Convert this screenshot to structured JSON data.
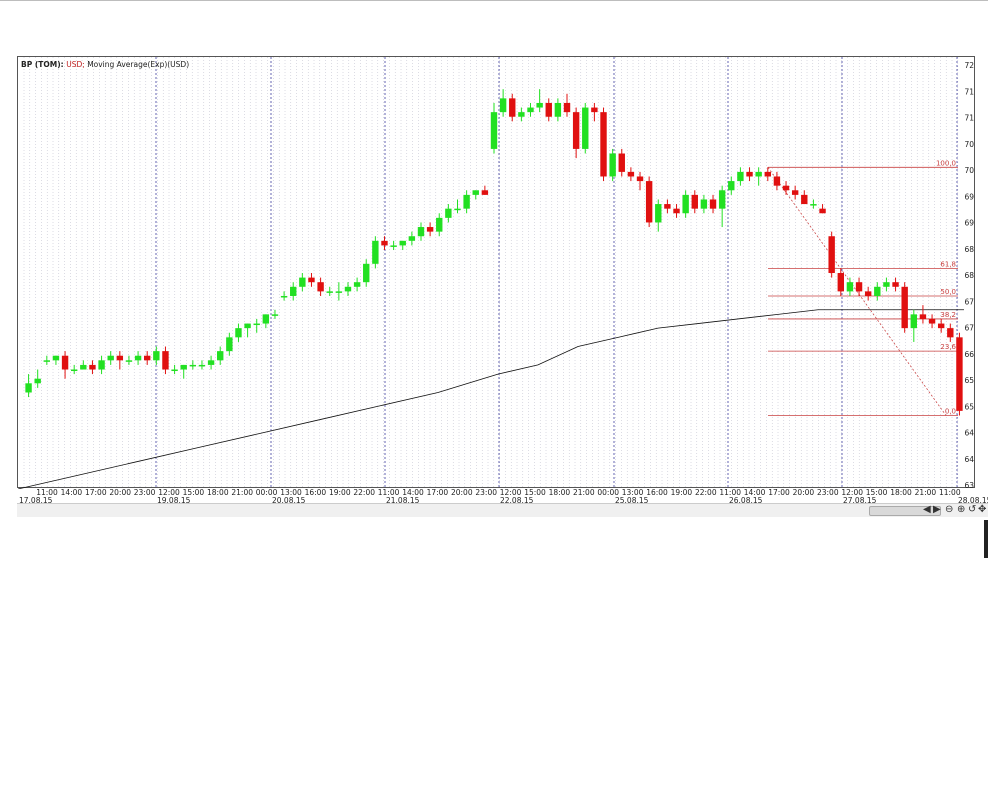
{
  "chart": {
    "legend_symbol": "BP (TOM):",
    "legend_currency": "USD;",
    "legend_indicator": "Moving Average(Exp)(USD)",
    "up_color": "#22e022",
    "down_color": "#e01010",
    "fib_color": "#c84040",
    "grid_color": "#b8b8c8",
    "day_sep_color": "#4040a0"
  },
  "icons": [
    "scroll-left-icon",
    "scroll-right-icon",
    "zoom-out-icon",
    "zoom-in-icon",
    "reset-icon",
    "move-icon"
  ],
  "chart_data": {
    "type": "candlestick",
    "ylim": [
      62.8,
      72.2
    ],
    "y_ticks": [
      "63",
      "64",
      "64",
      "65",
      "65",
      "66",
      "67",
      "67",
      "68",
      "68",
      "69",
      "69",
      "70",
      "70",
      "71",
      "71",
      "72"
    ],
    "time_labels": [
      "11:00",
      "14:00",
      "17:00",
      "20:00",
      "23:00",
      "12:00",
      "15:00",
      "18:00",
      "21:00",
      "00:00",
      "13:00",
      "16:00",
      "19:00",
      "22:00",
      "11:00",
      "14:00",
      "17:00",
      "20:00",
      "23:00",
      "12:00",
      "15:00",
      "18:00",
      "21:00",
      "00:00",
      "13:00",
      "16:00",
      "19:00",
      "22:00",
      "11:00",
      "14:00",
      "17:00",
      "20:00",
      "23:00",
      "12:00",
      "15:00",
      "18:00",
      "21:00",
      "11:00"
    ],
    "date_labels": [
      "17.08.15",
      "19.08.15",
      "20.08.15",
      "21.08.15",
      "22.08.15",
      "25.08.15",
      "26.08.15",
      "27.08.15",
      "28.08.15"
    ],
    "fib_levels": [
      "100,0",
      "61,8",
      "50,0",
      "38,2",
      "23,6",
      "0,0"
    ],
    "fib_values": [
      69.8,
      67.6,
      67.0,
      66.5,
      65.8,
      64.4
    ],
    "candles": [
      [
        64.9,
        65.3,
        64.8,
        65.1
      ],
      [
        65.1,
        65.4,
        65.0,
        65.2
      ],
      [
        65.6,
        65.7,
        65.5,
        65.6
      ],
      [
        65.6,
        65.7,
        65.5,
        65.7
      ],
      [
        65.7,
        65.8,
        65.2,
        65.4
      ],
      [
        65.4,
        65.5,
        65.3,
        65.4
      ],
      [
        65.4,
        65.6,
        65.4,
        65.5
      ],
      [
        65.5,
        65.6,
        65.3,
        65.4
      ],
      [
        65.4,
        65.7,
        65.3,
        65.6
      ],
      [
        65.6,
        65.8,
        65.5,
        65.7
      ],
      [
        65.7,
        65.8,
        65.4,
        65.6
      ],
      [
        65.6,
        65.7,
        65.5,
        65.6
      ],
      [
        65.6,
        65.8,
        65.5,
        65.7
      ],
      [
        65.7,
        65.8,
        65.5,
        65.6
      ],
      [
        65.6,
        65.9,
        65.5,
        65.8
      ],
      [
        65.8,
        65.9,
        65.3,
        65.4
      ],
      [
        65.4,
        65.5,
        65.3,
        65.4
      ],
      [
        65.4,
        65.5,
        65.2,
        65.5
      ],
      [
        65.5,
        65.6,
        65.4,
        65.5
      ],
      [
        65.5,
        65.6,
        65.4,
        65.5
      ],
      [
        65.5,
        65.7,
        65.4,
        65.6
      ],
      [
        65.6,
        65.9,
        65.5,
        65.8
      ],
      [
        65.8,
        66.2,
        65.7,
        66.1
      ],
      [
        66.1,
        66.4,
        66.0,
        66.3
      ],
      [
        66.3,
        66.4,
        66.1,
        66.4
      ],
      [
        66.4,
        66.5,
        66.2,
        66.4
      ],
      [
        66.4,
        66.6,
        66.3,
        66.6
      ],
      [
        66.6,
        66.7,
        66.5,
        66.6
      ],
      [
        67.0,
        67.1,
        66.9,
        67.0
      ],
      [
        67.0,
        67.3,
        66.9,
        67.2
      ],
      [
        67.2,
        67.5,
        67.1,
        67.4
      ],
      [
        67.4,
        67.5,
        67.2,
        67.3
      ],
      [
        67.3,
        67.4,
        67.0,
        67.1
      ],
      [
        67.1,
        67.2,
        67.0,
        67.1
      ],
      [
        67.1,
        67.3,
        66.9,
        67.1
      ],
      [
        67.1,
        67.3,
        67.0,
        67.2
      ],
      [
        67.2,
        67.4,
        67.1,
        67.3
      ],
      [
        67.3,
        67.8,
        67.2,
        67.7
      ],
      [
        67.7,
        68.3,
        67.6,
        68.2
      ],
      [
        68.2,
        68.3,
        68.0,
        68.1
      ],
      [
        68.1,
        68.2,
        68.0,
        68.1
      ],
      [
        68.1,
        68.2,
        68.0,
        68.2
      ],
      [
        68.2,
        68.4,
        68.1,
        68.3
      ],
      [
        68.3,
        68.6,
        68.2,
        68.5
      ],
      [
        68.5,
        68.6,
        68.3,
        68.4
      ],
      [
        68.4,
        68.8,
        68.3,
        68.7
      ],
      [
        68.7,
        69.0,
        68.6,
        68.9
      ],
      [
        68.9,
        69.1,
        68.8,
        68.9
      ],
      [
        68.9,
        69.3,
        68.8,
        69.2
      ],
      [
        69.2,
        69.3,
        69.1,
        69.3
      ],
      [
        69.3,
        69.4,
        69.2,
        69.2
      ],
      [
        70.2,
        71.2,
        70.1,
        71.0
      ],
      [
        71.0,
        71.5,
        70.9,
        71.3
      ],
      [
        71.3,
        71.4,
        70.8,
        70.9
      ],
      [
        70.9,
        71.1,
        70.8,
        71.0
      ],
      [
        71.0,
        71.2,
        70.9,
        71.1
      ],
      [
        71.1,
        71.5,
        71.0,
        71.2
      ],
      [
        71.2,
        71.3,
        70.8,
        70.9
      ],
      [
        70.9,
        71.3,
        70.8,
        71.2
      ],
      [
        71.2,
        71.4,
        70.9,
        71.0
      ],
      [
        71.0,
        71.1,
        70.0,
        70.2
      ],
      [
        70.2,
        71.2,
        70.1,
        71.1
      ],
      [
        71.1,
        71.2,
        70.8,
        71.0
      ],
      [
        71.0,
        71.1,
        69.5,
        69.6
      ],
      [
        69.6,
        70.2,
        69.5,
        70.1
      ],
      [
        70.1,
        70.2,
        69.6,
        69.7
      ],
      [
        69.7,
        69.8,
        69.5,
        69.6
      ],
      [
        69.6,
        69.7,
        69.3,
        69.5
      ],
      [
        69.5,
        69.6,
        68.5,
        68.6
      ],
      [
        68.6,
        69.1,
        68.4,
        69.0
      ],
      [
        69.0,
        69.1,
        68.8,
        68.9
      ],
      [
        68.9,
        69.0,
        68.7,
        68.8
      ],
      [
        68.8,
        69.3,
        68.7,
        69.2
      ],
      [
        69.2,
        69.3,
        68.8,
        68.9
      ],
      [
        68.9,
        69.2,
        68.8,
        69.1
      ],
      [
        69.1,
        69.2,
        68.8,
        68.9
      ],
      [
        68.9,
        69.4,
        68.5,
        69.3
      ],
      [
        69.3,
        69.6,
        69.2,
        69.5
      ],
      [
        69.5,
        69.8,
        69.4,
        69.7
      ],
      [
        69.7,
        69.8,
        69.5,
        69.6
      ],
      [
        69.6,
        69.8,
        69.4,
        69.7
      ],
      [
        69.7,
        69.8,
        69.5,
        69.6
      ],
      [
        69.6,
        69.7,
        69.3,
        69.4
      ],
      [
        69.4,
        69.5,
        69.2,
        69.3
      ],
      [
        69.3,
        69.4,
        69.1,
        69.2
      ],
      [
        69.2,
        69.3,
        69.0,
        69.0
      ],
      [
        69.0,
        69.1,
        68.9,
        69.0
      ],
      [
        68.9,
        69.0,
        68.8,
        68.8
      ],
      [
        68.3,
        68.4,
        67.4,
        67.5
      ],
      [
        67.5,
        67.6,
        67.0,
        67.1
      ],
      [
        67.1,
        67.4,
        67.0,
        67.3
      ],
      [
        67.3,
        67.4,
        67.0,
        67.1
      ],
      [
        67.1,
        67.2,
        66.9,
        67.0
      ],
      [
        67.0,
        67.3,
        66.9,
        67.2
      ],
      [
        67.2,
        67.4,
        67.1,
        67.3
      ],
      [
        67.3,
        67.4,
        67.1,
        67.2
      ],
      [
        67.2,
        67.3,
        66.2,
        66.3
      ],
      [
        66.3,
        66.7,
        66.0,
        66.6
      ],
      [
        66.6,
        66.8,
        66.4,
        66.5
      ],
      [
        66.5,
        66.6,
        66.3,
        66.4
      ],
      [
        66.4,
        66.5,
        66.2,
        66.3
      ],
      [
        66.3,
        66.4,
        66.0,
        66.1
      ],
      [
        66.1,
        66.2,
        64.4,
        64.5
      ]
    ],
    "moving_average": [
      [
        0,
        62.8
      ],
      [
        60,
        63.1
      ],
      [
        120,
        63.4
      ],
      [
        180,
        63.7
      ],
      [
        240,
        64.0
      ],
      [
        300,
        64.3
      ],
      [
        360,
        64.6
      ],
      [
        420,
        64.9
      ],
      [
        480,
        65.3
      ],
      [
        520,
        65.5
      ],
      [
        560,
        65.9
      ],
      [
        600,
        66.1
      ],
      [
        640,
        66.3
      ],
      [
        680,
        66.4
      ],
      [
        720,
        66.5
      ],
      [
        760,
        66.6
      ],
      [
        800,
        66.7
      ],
      [
        840,
        66.7
      ],
      [
        880,
        66.7
      ],
      [
        920,
        66.7
      ],
      [
        946,
        66.7
      ]
    ]
  }
}
